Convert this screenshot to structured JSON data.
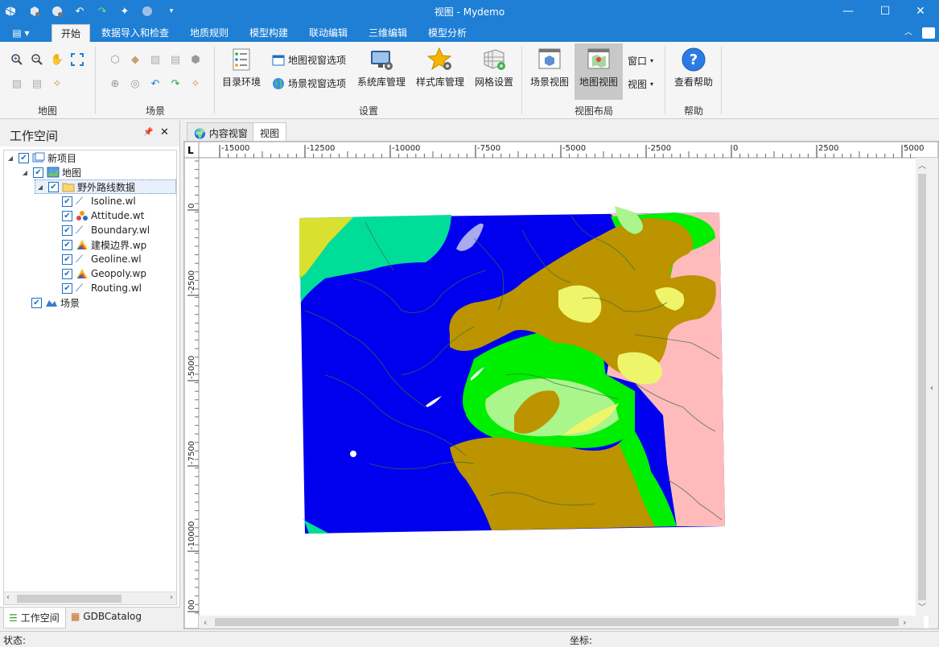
{
  "window": {
    "title": "视图 - Mydemo",
    "minimize": "—",
    "maximize": "☐",
    "close": "✕"
  },
  "menu": {
    "tabs": [
      "开始",
      "数据导入和检查",
      "地质规则",
      "模型构建",
      "联动编辑",
      "三维编辑",
      "模型分析"
    ],
    "active": 0
  },
  "ribbon": {
    "groups": {
      "map": "地图",
      "scene": "场景",
      "settings": "设置",
      "layout": "视图布局",
      "help": "帮助"
    },
    "catalog_env": "目录环境",
    "map_view_options": "地图视窗选项",
    "scene_view_options": "场景视窗选项",
    "sys_lib_mgmt": "系统库管理",
    "style_lib_mgmt": "样式库管理",
    "grid_settings": "网格设置",
    "scene_view": "场景视图",
    "map_view": "地图视图",
    "window": "窗口",
    "view": "视图",
    "view_help": "查看帮助"
  },
  "workspace": {
    "title": "工作空间",
    "pin": "📌",
    "close": "✕",
    "tree": {
      "project": "新项目",
      "map": "地图",
      "folder": "野外路线数据",
      "layers": [
        "Isoline.wl",
        "Attitude.wt",
        "Boundary.wl",
        "建模边界.wp",
        "Geoline.wl",
        "Geopoly.wp",
        "Routing.wl"
      ],
      "scene": "场景"
    },
    "bottom_tabs": [
      "工作空间",
      "GDBCatalog"
    ]
  },
  "doc_tabs": [
    "内容视窗",
    "视图"
  ],
  "ruler": {
    "corner": "L",
    "h_ticks": [
      "-15000",
      "-12500",
      "-10000",
      "-7500",
      "-5000",
      "-2500",
      "0",
      "2500",
      "5000"
    ],
    "v_ticks": [
      "0",
      "-2500",
      "-5000",
      "-7500",
      "-10000",
      "00"
    ]
  },
  "map_colors": {
    "blue": "#0000ee",
    "teal": "#00dd99",
    "olive": "#bb9400",
    "green": "#00ee00",
    "pink": "#ffbbbb",
    "light_yellow": "#eef56a",
    "light_green": "#aaf58c",
    "lavender": "#aaaaee"
  },
  "status": {
    "state_label": "状态:",
    "coord_label": "坐标:"
  }
}
